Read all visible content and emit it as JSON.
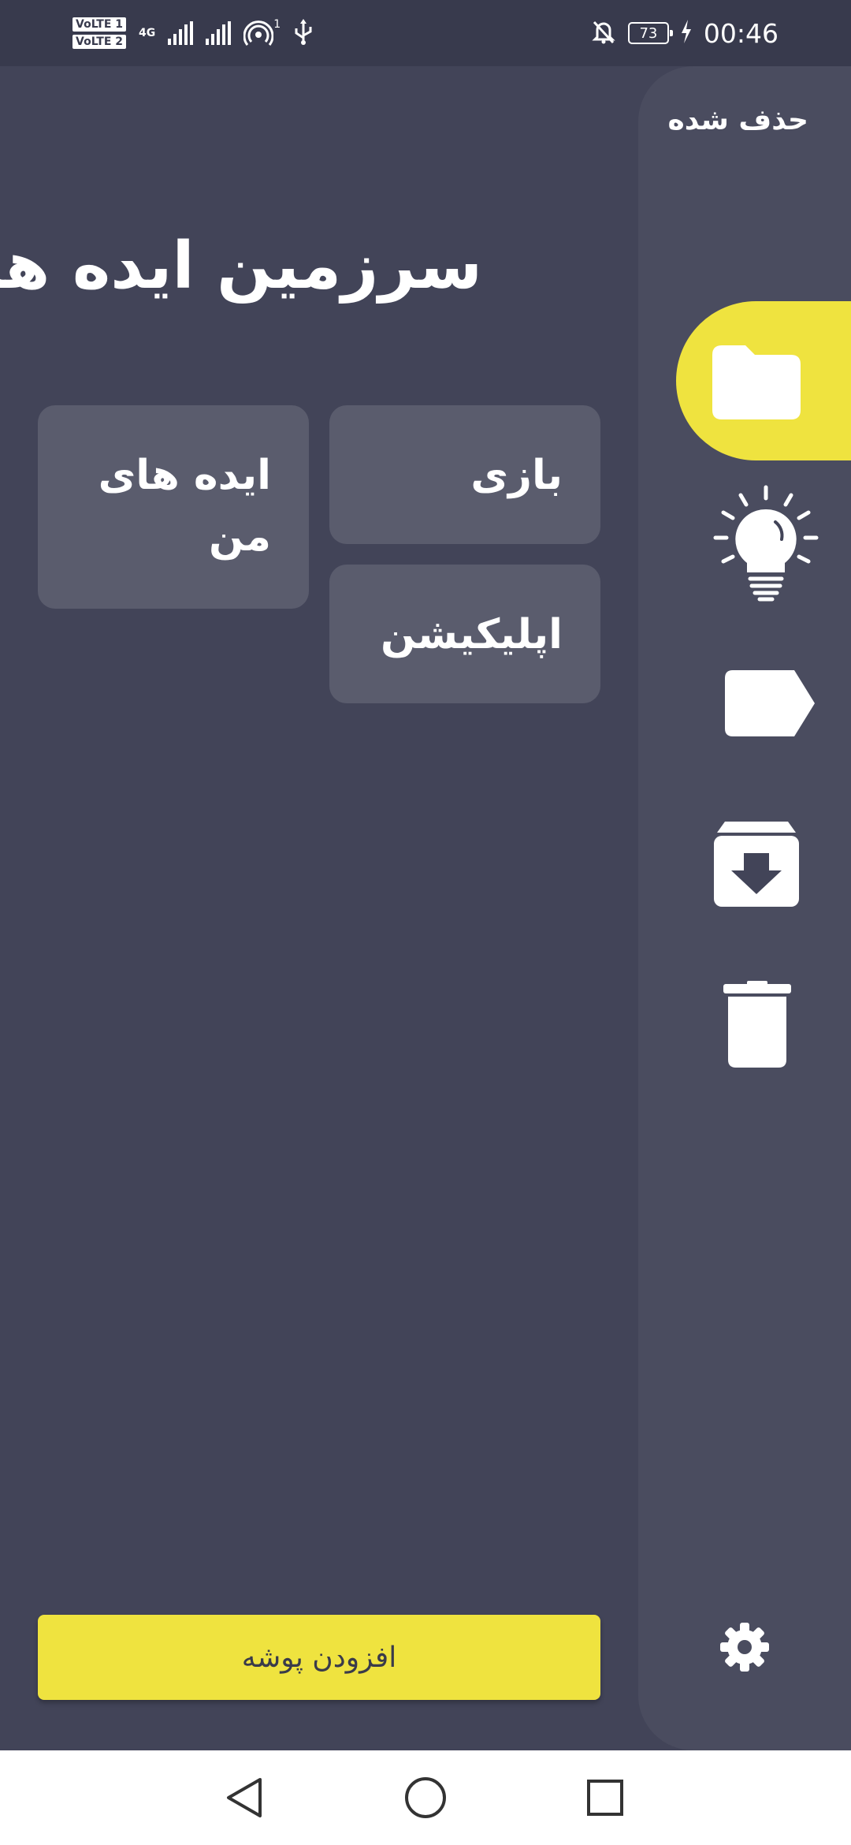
{
  "status_bar": {
    "sim1": "VoLTE 1",
    "sim2": "VoLTE 2",
    "network": "4G",
    "hotspot_count": "1",
    "battery": "73",
    "time": "00:46",
    "icons": [
      "volte-icon",
      "signal-icon",
      "hotspot-icon",
      "usb-icon",
      "mute-icon",
      "battery-icon",
      "charging-icon"
    ]
  },
  "drawer": {
    "title": "حذف شده",
    "items": [
      {
        "icon": "folder-icon",
        "selected": true
      },
      {
        "icon": "lightbulb-icon",
        "selected": false
      },
      {
        "icon": "label-icon",
        "selected": false
      },
      {
        "icon": "archive-icon",
        "selected": false
      },
      {
        "icon": "trash-icon",
        "selected": false
      }
    ],
    "settings_icon": "gear-icon"
  },
  "main": {
    "title": "سرزمین ایده ها",
    "folders": [
      {
        "label": "بازی"
      },
      {
        "label": "ایده های من"
      },
      {
        "label": "اپلیکیشن"
      }
    ],
    "add_button": "افزودن پوشه"
  },
  "colors": {
    "background": "#424458",
    "rail": "#4a4c5f",
    "card": "#5a5c6d",
    "accent": "#efe33f"
  },
  "nav_bar": {
    "icons": [
      "back-icon",
      "home-icon",
      "recents-icon"
    ]
  }
}
